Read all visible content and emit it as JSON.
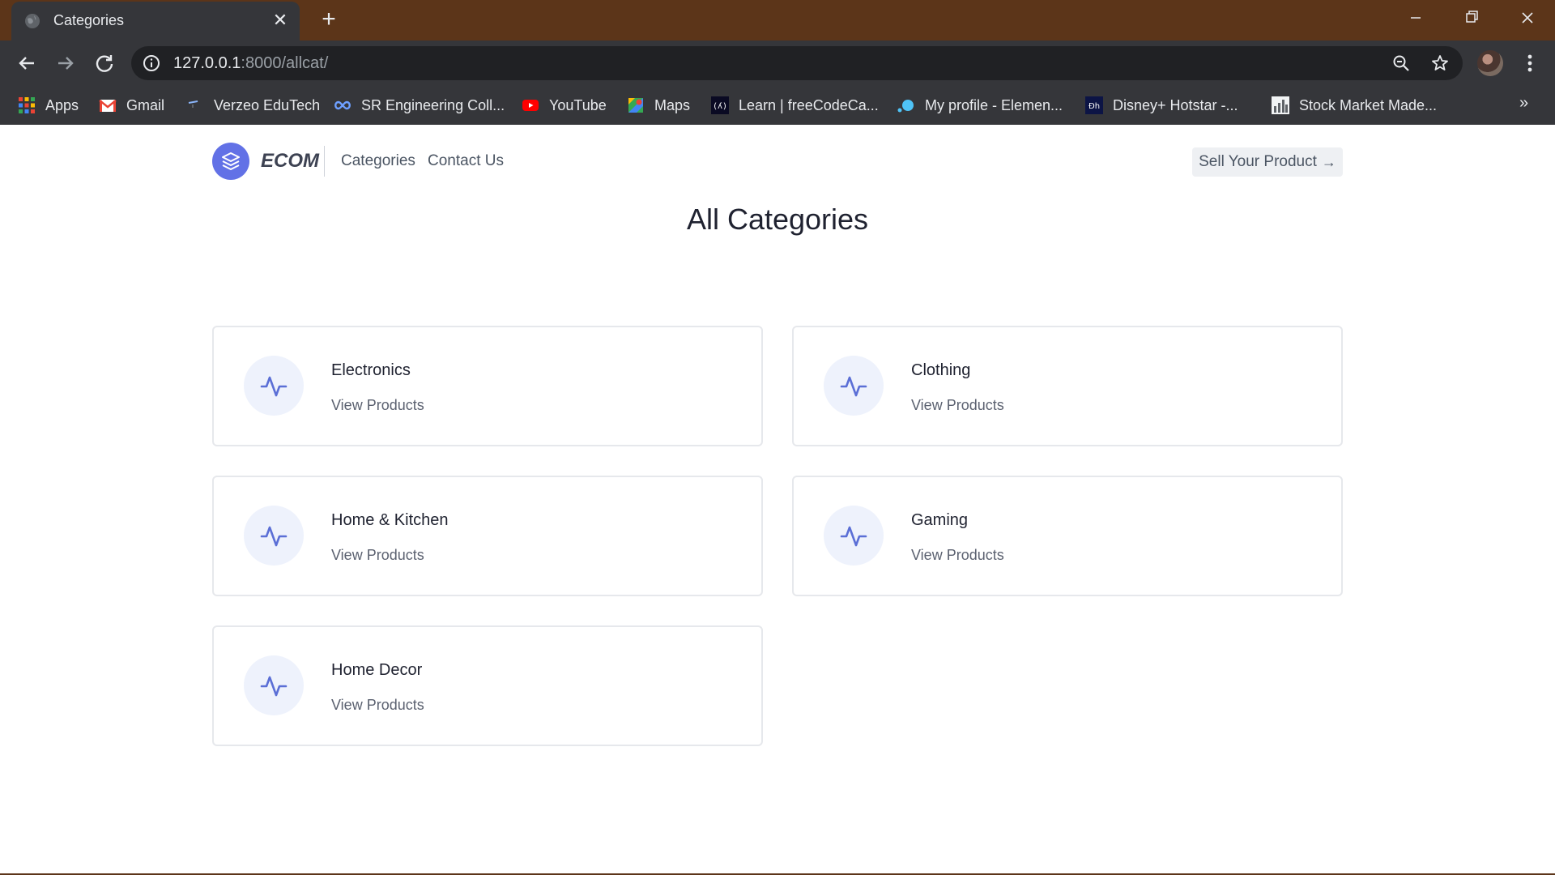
{
  "browser": {
    "tab_title": "Categories",
    "url_host": "127.0.0.1",
    "url_rest": ":8000/allcat/",
    "bookmarks": [
      {
        "label": "Apps",
        "icon": "apps-grid-icon"
      },
      {
        "label": "Gmail",
        "icon": "gmail-icon"
      },
      {
        "label": "Verzeo EduTech",
        "icon": "verzeo-icon"
      },
      {
        "label": "SR Engineering Coll...",
        "icon": "sr-engineering-icon"
      },
      {
        "label": "YouTube",
        "icon": "youtube-icon"
      },
      {
        "label": "Maps",
        "icon": "maps-icon"
      },
      {
        "label": "Learn | freeCodeCa...",
        "icon": "freecodecamp-icon"
      },
      {
        "label": "My profile - Elemen...",
        "icon": "element-icon"
      },
      {
        "label": "Disney+ Hotstar -...",
        "icon": "hotstar-icon"
      },
      {
        "label": "Stock Market Made...",
        "icon": "stock-market-icon"
      }
    ],
    "more_bookmarks": "»"
  },
  "header": {
    "brand": "ECOM",
    "nav": [
      "Categories",
      "Contact Us"
    ],
    "cta": "Sell Your Product",
    "cta_arrow": "→"
  },
  "main": {
    "title": "All Categories",
    "categories": [
      {
        "name": "Electronics",
        "link": "View Products"
      },
      {
        "name": "Clothing",
        "link": "View Products"
      },
      {
        "name": "Home & Kitchen",
        "link": "View Products"
      },
      {
        "name": "Gaming",
        "link": "View Products"
      },
      {
        "name": "Home Decor",
        "link": "View Products"
      }
    ]
  },
  "colors": {
    "brand": "#6271e6",
    "tabstrip": "#5c3519",
    "chrome": "#35363a"
  }
}
